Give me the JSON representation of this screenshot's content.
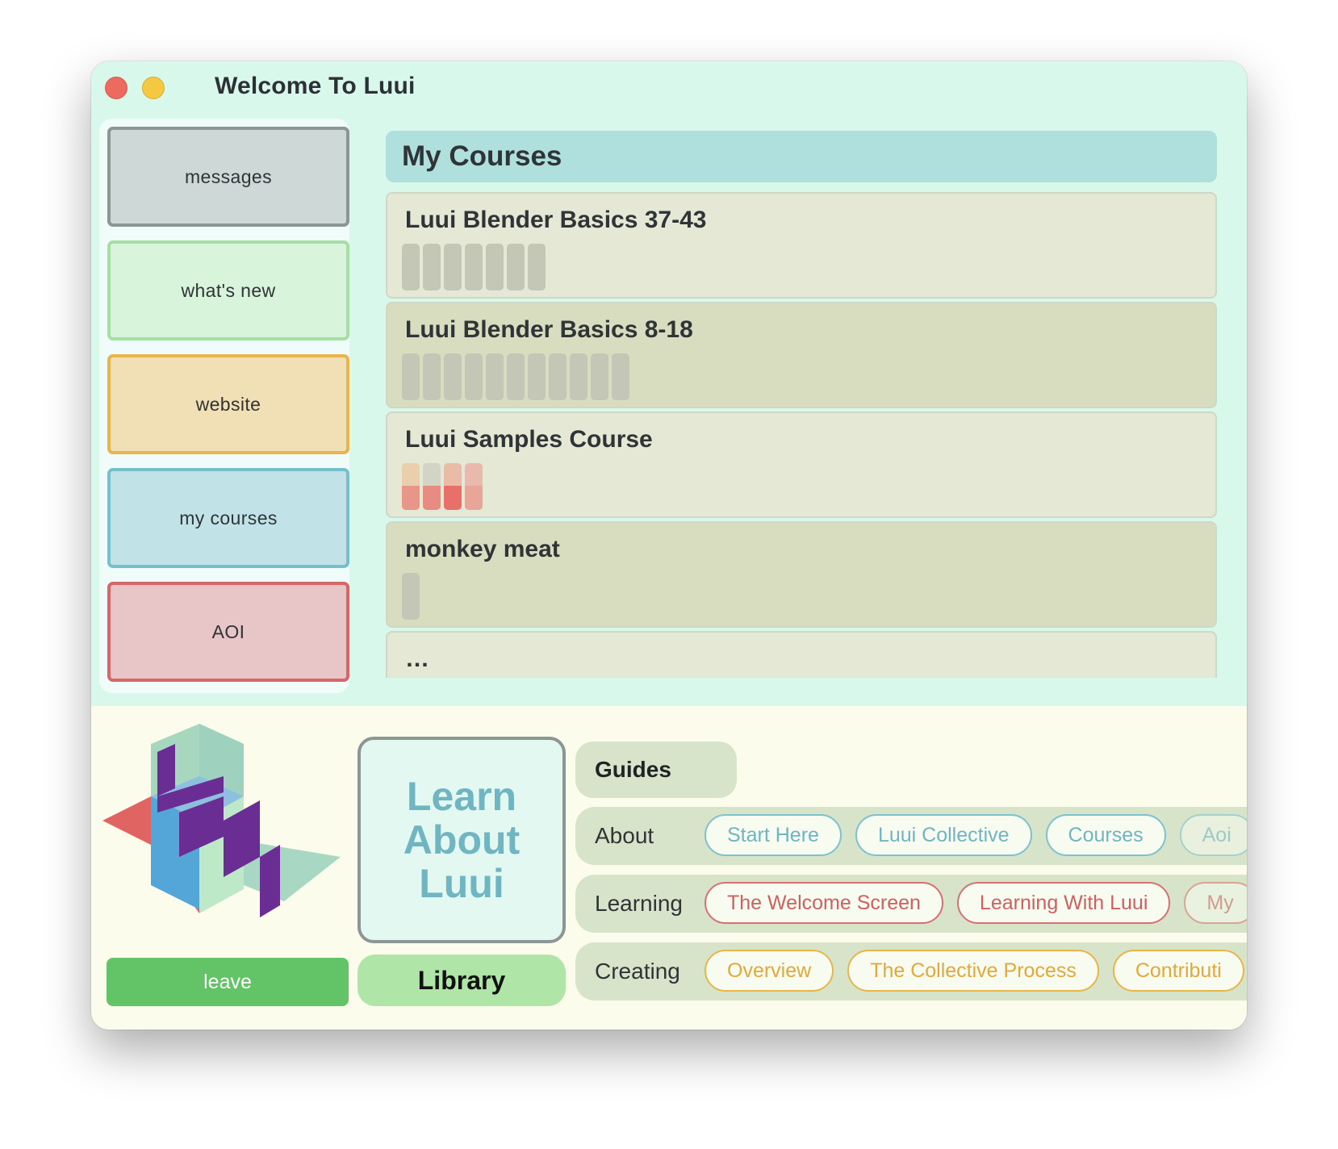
{
  "window": {
    "title": "Welcome To Luui"
  },
  "sidebar": {
    "items": [
      {
        "label": "messages"
      },
      {
        "label": "what's new"
      },
      {
        "label": "website"
      },
      {
        "label": "my courses"
      },
      {
        "label": "AOI"
      }
    ]
  },
  "courses": {
    "header": "My Courses",
    "items": [
      {
        "title": "Luui Blender Basics 37-43",
        "segments": 7
      },
      {
        "title": "Luui Blender Basics 8-18",
        "segments": 11
      },
      {
        "title": "Luui Samples Course",
        "segments": 4
      },
      {
        "title": "monkey meat",
        "segments": 1
      },
      {
        "title": "…"
      }
    ]
  },
  "bottom": {
    "leave_label": "leave",
    "learn_label": "Learn About Luui",
    "library_label": "Library",
    "guides_label": "Guides",
    "rows": [
      {
        "label": "About",
        "pills": [
          "Start Here",
          "Luui Collective",
          "Courses",
          "Aoi"
        ]
      },
      {
        "label": "Learning",
        "pills": [
          "The Welcome Screen",
          "Learning With Luui",
          "My"
        ]
      },
      {
        "label": "Creating",
        "pills": [
          "Overview",
          "The Collective Process",
          "Contributi"
        ]
      }
    ]
  },
  "colors": {
    "window_bg": "#d9f8ec",
    "bottom_bg": "#fcfcec",
    "accent_blue": "#6fb5c2",
    "accent_red": "#d06060",
    "accent_orange": "#e2a83a",
    "leave_green": "#62c367"
  }
}
